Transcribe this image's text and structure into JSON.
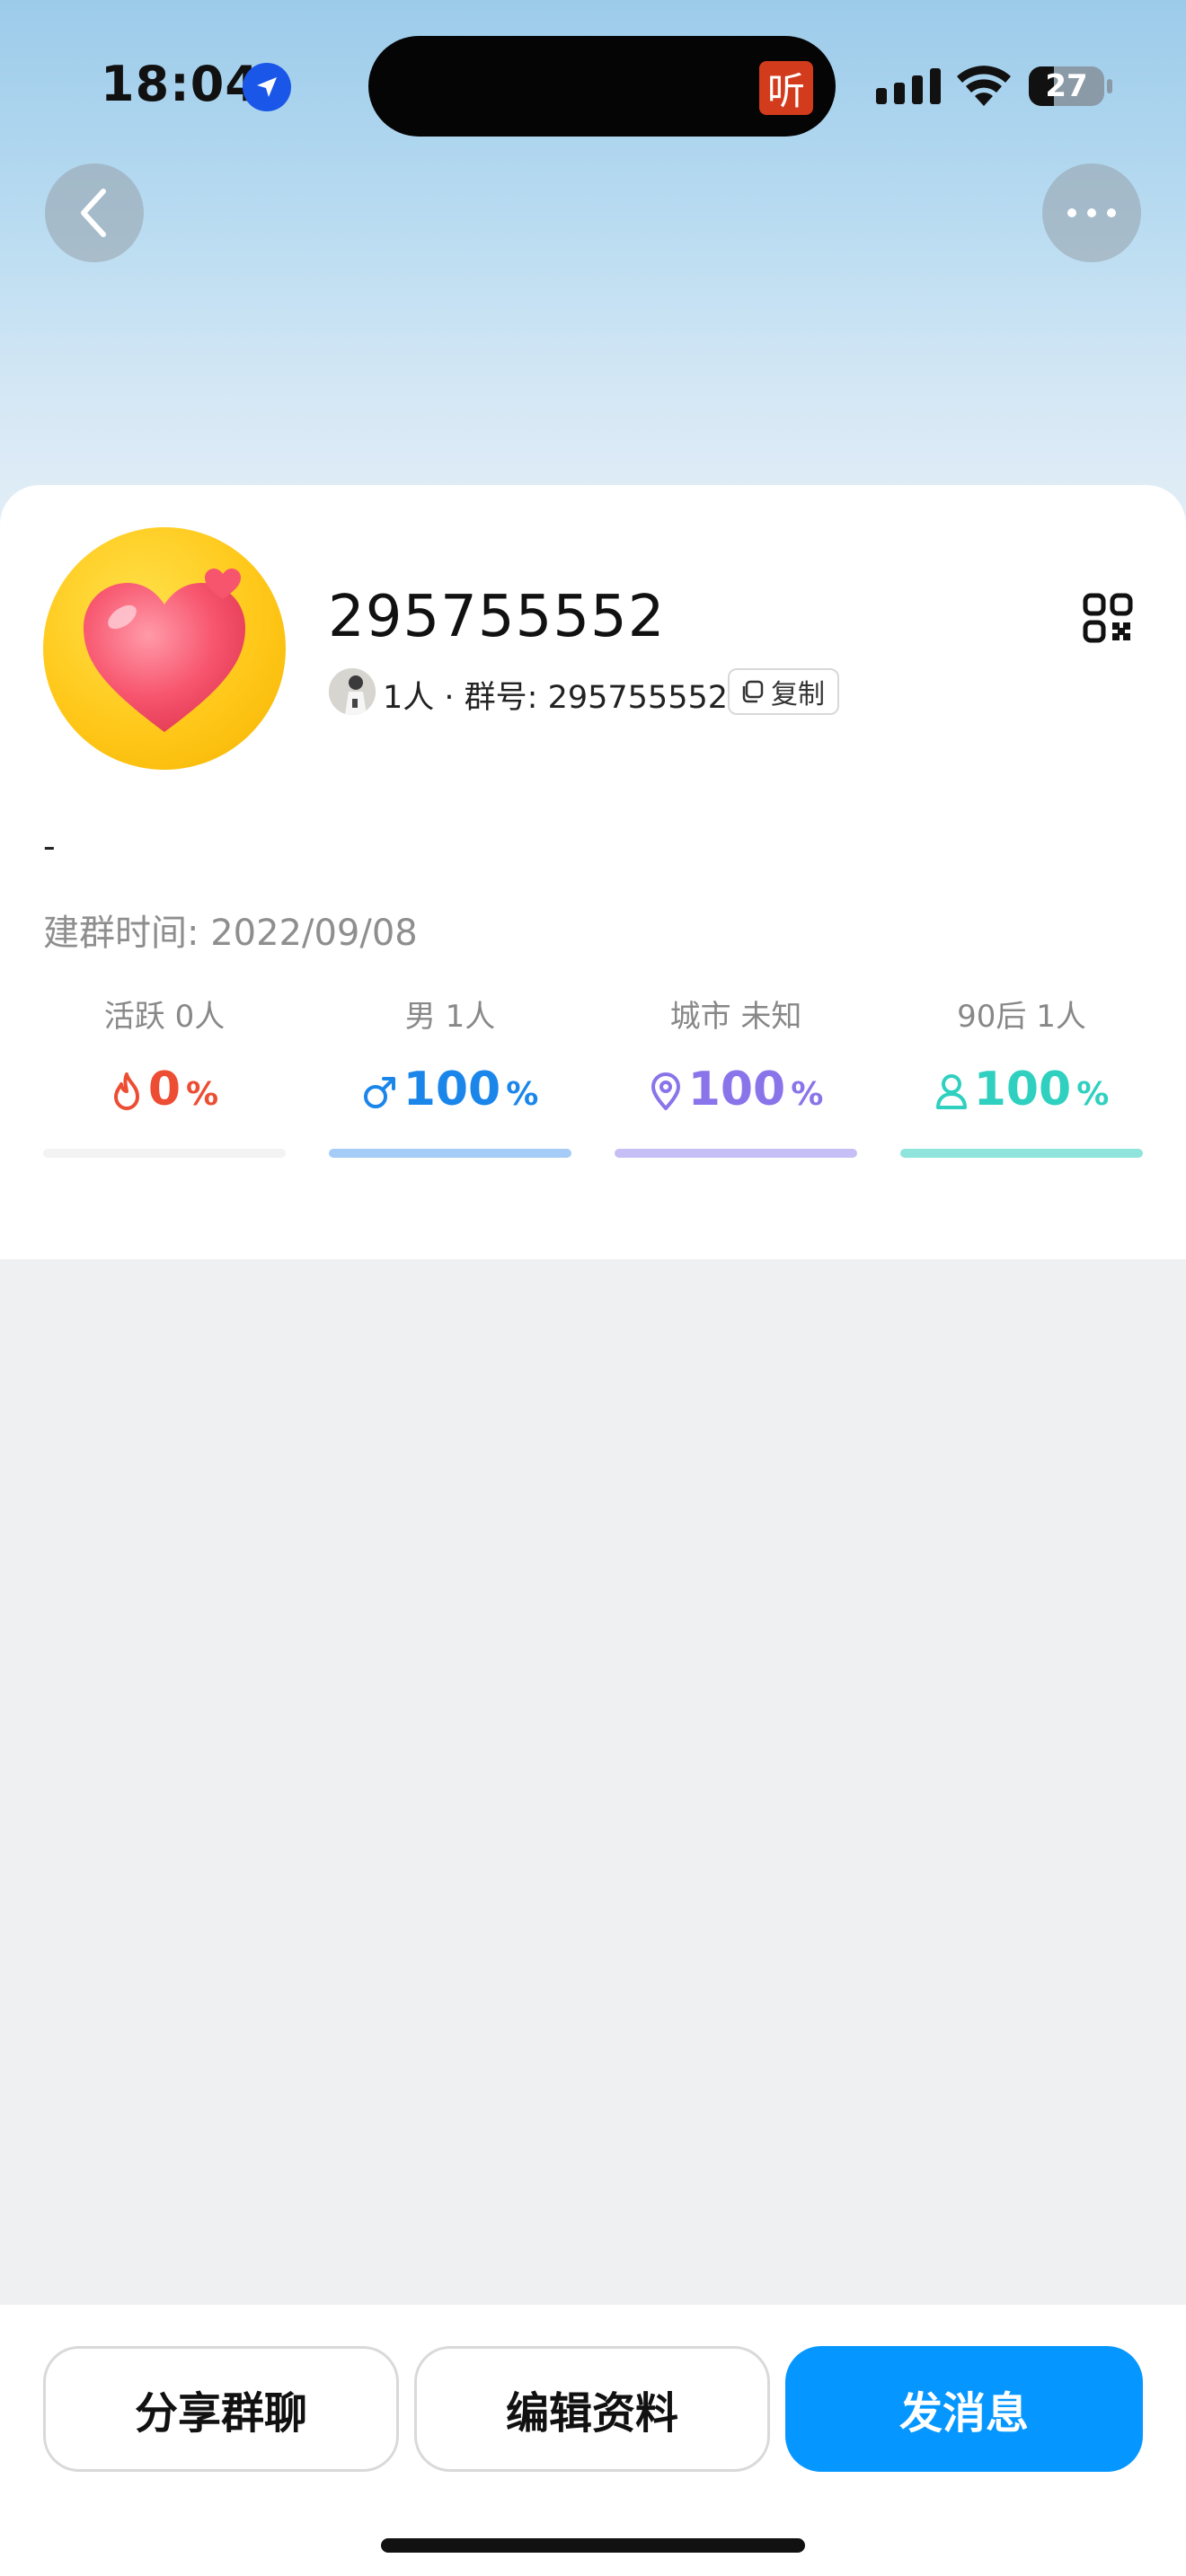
{
  "status_bar": {
    "time": "18:04",
    "listen_badge": "听",
    "battery": "27",
    "icons": [
      "location-arrow-icon",
      "cellular-signal-icon",
      "wifi-icon",
      "battery-icon"
    ]
  },
  "nav": {
    "back_icon": "chevron-left-icon",
    "more_icon": "more-horizontal-icon"
  },
  "group": {
    "name": "295755552",
    "member_count_text": "1人",
    "separator": " · ",
    "group_number_text": "群号: 295755552",
    "copy_label": "复制",
    "description": "-",
    "created_label": "建群时间:",
    "created_date": "2022/09/08"
  },
  "stats": [
    {
      "label_main": "活跃",
      "label_value": "0人",
      "value": "0",
      "unit": "%",
      "icon": "flame-icon",
      "color": "#ec4d33",
      "bar_color": "#f3f3f3",
      "percent": 0
    },
    {
      "label_main": "男",
      "label_value": "1人",
      "value": "100",
      "unit": "%",
      "icon": "male-icon",
      "color": "#1b86ea",
      "bar_color": "#a5ccf7",
      "percent": 100
    },
    {
      "label_main": "城市",
      "label_value": "未知",
      "value": "100",
      "unit": "%",
      "icon": "location-pin-icon",
      "color": "#8a74ea",
      "bar_color": "#c6bff5",
      "percent": 100
    },
    {
      "label_main": "90后",
      "label_value": "1人",
      "value": "100",
      "unit": "%",
      "icon": "person-icon",
      "color": "#2fd0bf",
      "bar_color": "#8fe4dc",
      "percent": 100
    }
  ],
  "actions": {
    "share_label": "分享群聊",
    "edit_label": "编辑资料",
    "send_label": "发消息"
  },
  "colors": {
    "primary": "#0597ff",
    "background": "#eff0f2"
  }
}
